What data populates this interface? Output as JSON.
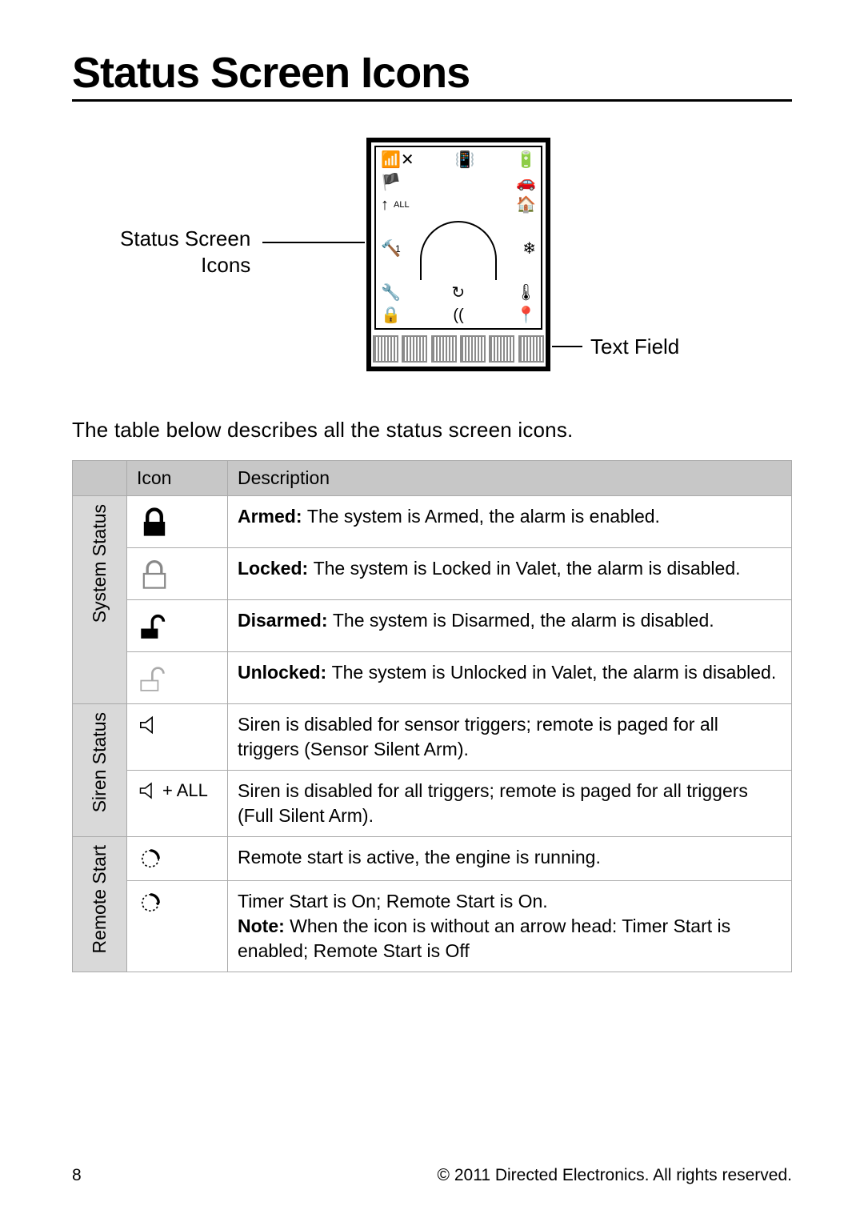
{
  "title": "Status Screen Icons",
  "diagram": {
    "label_left": "Status Screen\nIcons",
    "label_right": "Text Field",
    "all_text": "ALL",
    "one_text": "1"
  },
  "intro": "The table below describes all the status screen icons.",
  "table": {
    "headers": {
      "icon": "Icon",
      "description": "Description"
    },
    "groups": [
      {
        "name": "System Status",
        "rows": [
          {
            "icon": "armed-lock-icon",
            "bold": "Armed: ",
            "rest": "The system is Armed, the alarm is enabled."
          },
          {
            "icon": "locked-lock-icon",
            "bold": "Locked: ",
            "rest": "The system is Locked in Valet, the alarm is disabled."
          },
          {
            "icon": "disarmed-lock-icon",
            "bold": "Disarmed: ",
            "rest": "The system is Disarmed, the alarm is disabled."
          },
          {
            "icon": "unlocked-lock-icon",
            "bold": "Unlocked: ",
            "rest": "The system is Unlocked in Valet, the alarm is disabled."
          }
        ]
      },
      {
        "name": "Siren Status",
        "rows": [
          {
            "icon": "siren-icon",
            "bold": "",
            "rest": "Siren is disabled for sensor triggers; remote is paged for all triggers (Sensor Silent Arm)."
          },
          {
            "icon": "siren-all-icon",
            "extra_text": " + ALL",
            "bold": "",
            "rest": "Siren is disabled for all triggers; remote is paged for all triggers (Full Silent Arm)."
          }
        ]
      },
      {
        "name": "Remote Start",
        "rows": [
          {
            "icon": "remote-start-icon",
            "bold": "",
            "rest": "Remote start is active, the engine is running."
          },
          {
            "icon": "timer-start-icon",
            "bold": "",
            "rest": "Timer Start is On; Remote Start is On.",
            "note_bold": "Note: ",
            "note_rest": "When the icon is without an arrow head: Timer Start is enabled; Remote Start is Off"
          }
        ]
      }
    ]
  },
  "footer": {
    "page": "8",
    "copyright": "© 2011 Directed Electronics. All rights reserved."
  }
}
